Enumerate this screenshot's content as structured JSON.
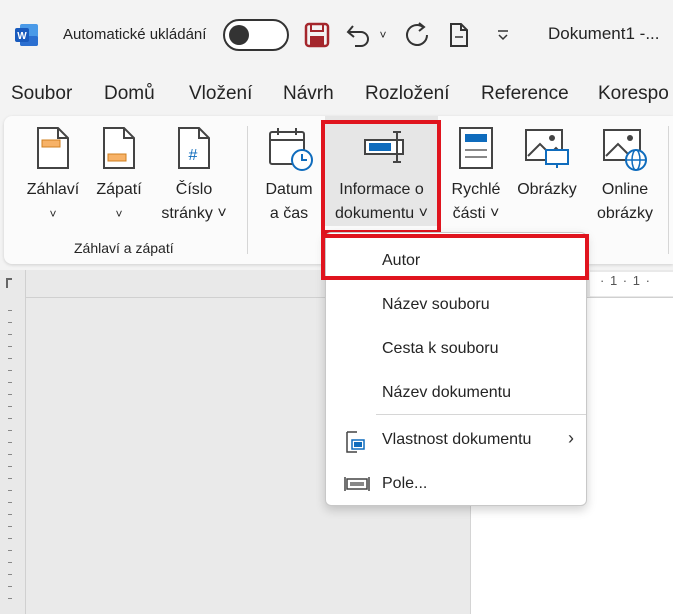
{
  "titlebar": {
    "autosave_label": "Automatické ukládání",
    "doc_title": "Dokument1  -..."
  },
  "menubar": {
    "items": [
      "Soubor",
      "Domů",
      "Vložení",
      "Návrh",
      "Rozložení",
      "Reference",
      "Korespo"
    ]
  },
  "ribbon": {
    "buttons": [
      {
        "line1": "Záhlaví",
        "line2": "˅"
      },
      {
        "line1": "Zápatí",
        "line2": "˅"
      },
      {
        "line1": "Číslo",
        "line2": "stránky ˅"
      },
      {
        "line1": "Datum",
        "line2": "a čas"
      },
      {
        "line1": "Informace o",
        "line2": "dokumentu ˅"
      },
      {
        "line1": "Rychlé",
        "line2": "části ˅"
      },
      {
        "line1": "Obrázky",
        "line2": ""
      },
      {
        "line1": "Online",
        "line2": "obrázky"
      }
    ],
    "group_label": "Záhlaví a zápatí"
  },
  "ruler": {
    "text": "· 1 · 1 ·"
  },
  "dropdown": {
    "items": [
      {
        "label": "Autor"
      },
      {
        "label": "Název souboru"
      },
      {
        "label": "Cesta k souboru"
      },
      {
        "label": "Název dokumentu"
      },
      {
        "label": "Vlastnost dokumentu",
        "arrow": "›"
      },
      {
        "label": "Pole..."
      }
    ]
  },
  "colors": {
    "accent": "#0f6cbd",
    "highlight": "#e0141e",
    "word_blue": "#185abd"
  }
}
